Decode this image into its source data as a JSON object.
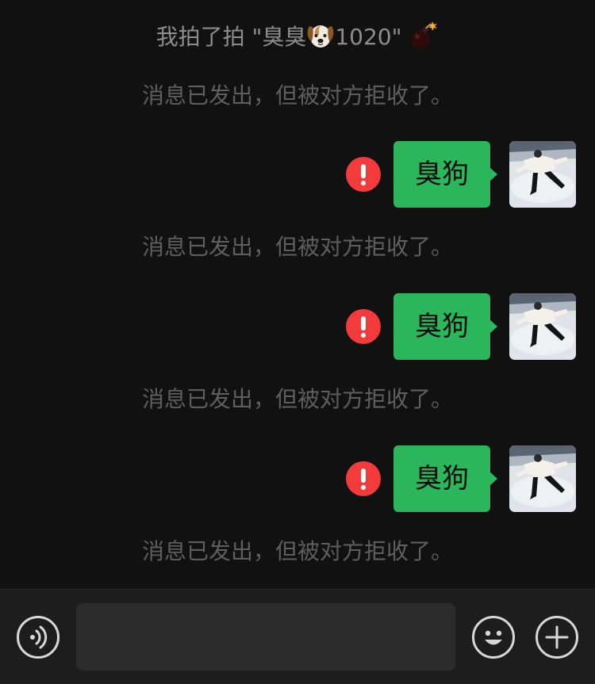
{
  "pat_notice": {
    "prefix": "我拍了拍 \"臭臭",
    "suffix": "1020\"",
    "emoji": "dog-face-icon",
    "bomb": "bomb-icon"
  },
  "messages": [
    {
      "text": "臭狗",
      "status": "error",
      "notice": "消息已发出，但被对方拒收了。"
    },
    {
      "text": "臭狗",
      "status": "error",
      "notice": "消息已发出，但被对方拒收了。"
    },
    {
      "text": "臭狗",
      "status": "error",
      "notice": "消息已发出，但被对方拒收了。"
    }
  ],
  "first_notice": "消息已发出，但被对方拒收了。",
  "input": {
    "value": "",
    "placeholder": ""
  },
  "colors": {
    "bubble": "#2bb65c",
    "error": "#f43b3b",
    "background": "#111111"
  },
  "icons": {
    "voice": "voice-icon",
    "emoji": "emoji-icon",
    "more": "plus-icon"
  }
}
